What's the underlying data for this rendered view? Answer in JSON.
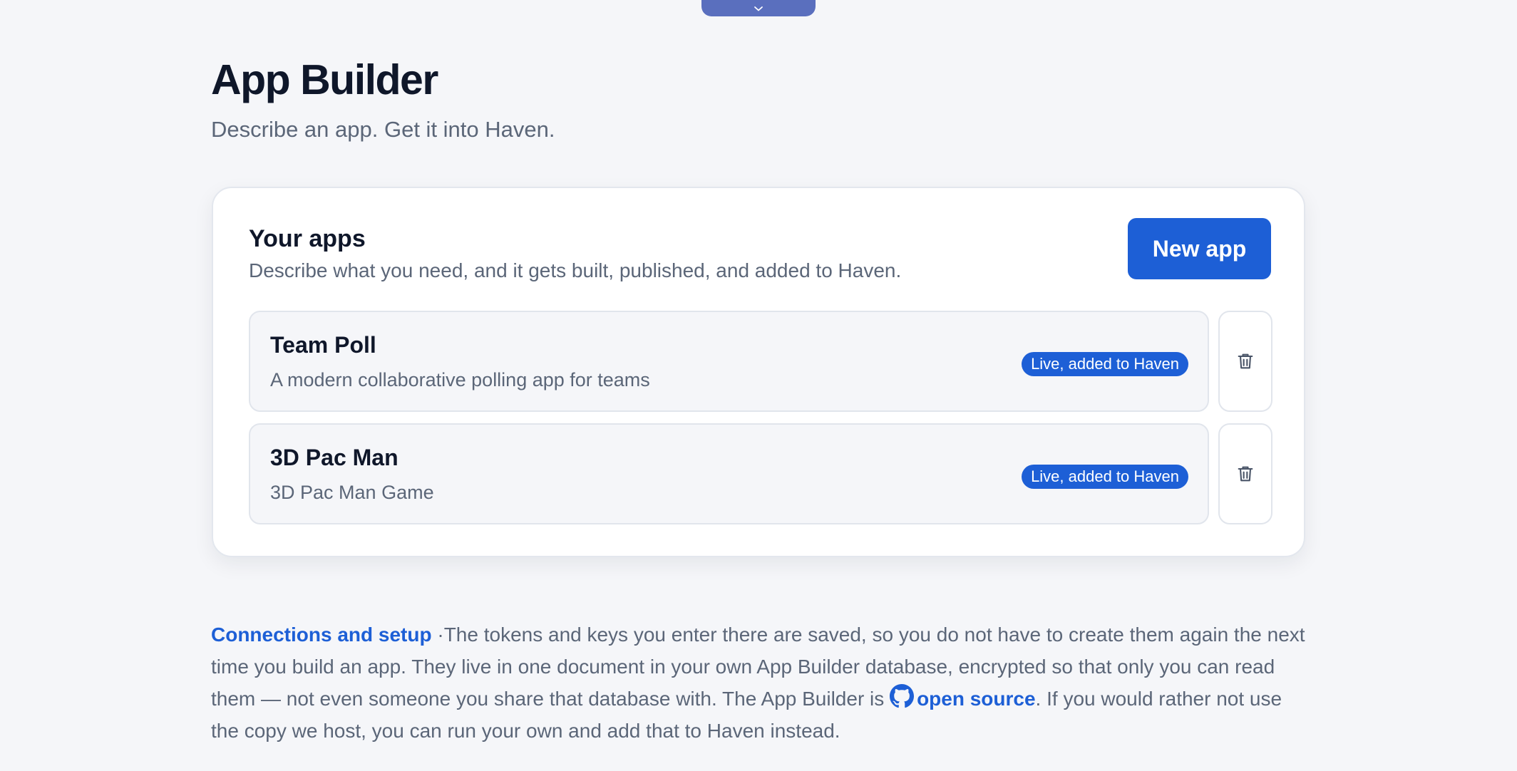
{
  "header": {
    "toggle_icon": "chevron-down-icon",
    "title": "App Builder",
    "subtitle": "Describe an app. Get it into Haven."
  },
  "apps_card": {
    "title": "Your apps",
    "description": "Describe what you need, and it gets built, published, and added to Haven.",
    "new_app_label": "New app",
    "apps": [
      {
        "name": "Team Poll",
        "description": "A modern collaborative polling app for teams",
        "status": "Live, added to Haven",
        "delete_icon": "trash-icon"
      },
      {
        "name": "3D Pac Man",
        "description": "3D Pac Man Game",
        "status": "Live, added to Haven",
        "delete_icon": "trash-icon"
      }
    ]
  },
  "footer": {
    "connections_link": "Connections and setup",
    "separator": " ·",
    "text_part1": "The tokens and keys you enter there are saved, so you do not have to create them again the next time you build an app. They live in one document in your own App Builder database, encrypted so that only you can read them — not even someone you share that database with. The App Builder is ",
    "github_icon": "github-icon",
    "open_source_link": "open source",
    "text_part2": ". If you would rather not use the copy we host, you can run your own and add that to Haven instead."
  },
  "colors": {
    "accent": "#1d5fd6",
    "background": "#f5f6f9",
    "tab": "#5a6fbe"
  }
}
